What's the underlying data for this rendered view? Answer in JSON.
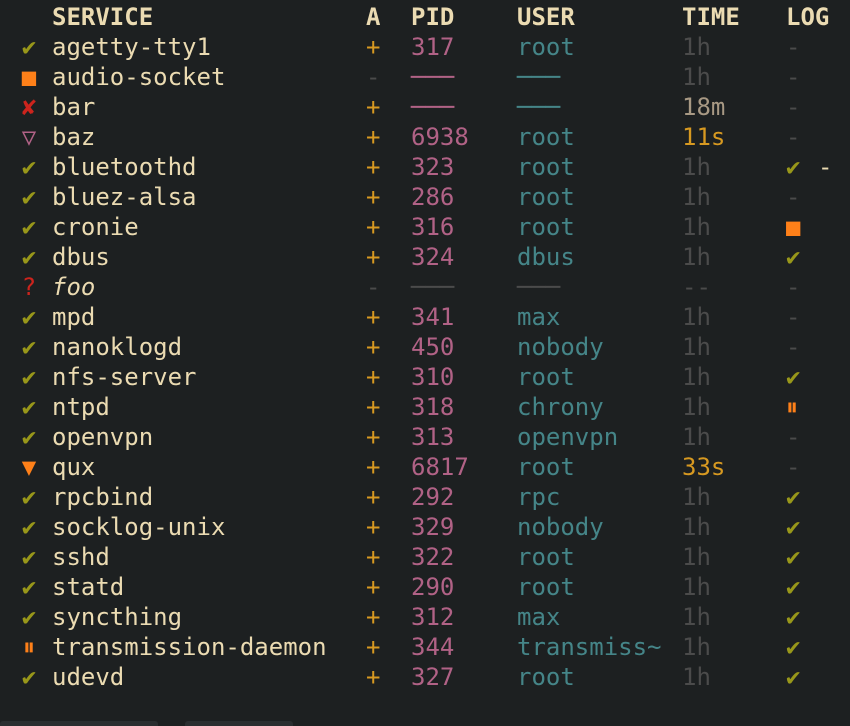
{
  "header": {
    "service": "SERVICE",
    "a": "A",
    "pid": "PID",
    "user": "USER",
    "time": "TIME",
    "log": "LOG"
  },
  "colors": {
    "bg": "#1d2021",
    "text": "#ebdbb2",
    "ok": "#98971a",
    "warn": "#fe8019",
    "err": "#cc241d",
    "pid": "#b16286",
    "user": "#458588",
    "dim": "#4b4b4b",
    "yellow": "#d79921"
  },
  "rows": [
    {
      "icon": "✔",
      "iconName": "check-icon",
      "iconClass": "green",
      "service": "agetty-tty1",
      "a": "+",
      "aClass": "yellow",
      "pid": "317",
      "pidClass": "pink",
      "user": "root",
      "userClass": "",
      "time": "1h",
      "timeClass": "dim",
      "log": "-",
      "logClass": "dim"
    },
    {
      "icon": "■",
      "iconName": "stopped-square-icon",
      "iconClass": "orange",
      "service": "audio-socket",
      "a": "-",
      "aClass": "dim",
      "pid": "───",
      "pidClass": "pink",
      "user": "───",
      "userClass": "",
      "time": "1h",
      "timeClass": "dim",
      "log": "-",
      "logClass": "dim"
    },
    {
      "icon": "✘",
      "iconName": "cross-icon",
      "iconClass": "red",
      "service": "bar",
      "a": "+",
      "aClass": "yellow",
      "pid": "───",
      "pidClass": "pink",
      "user": "───",
      "userClass": "",
      "time": "18m",
      "timeClass": "grey",
      "log": "-",
      "logClass": "dim"
    },
    {
      "icon": "▽",
      "iconName": "triangle-down-outline-icon",
      "iconClass": "pink",
      "service": "baz",
      "a": "+",
      "aClass": "yellow",
      "pid": "6938",
      "pidClass": "pink",
      "user": "root",
      "userClass": "",
      "time": "11s",
      "timeClass": "yellow",
      "log": "-",
      "logClass": "dim"
    },
    {
      "icon": "✔",
      "iconName": "check-icon",
      "iconClass": "green",
      "service": "bluetoothd",
      "a": "+",
      "aClass": "yellow",
      "pid": "323",
      "pidClass": "pink",
      "user": "root",
      "userClass": "",
      "time": "1h",
      "timeClass": "dim",
      "log": "✔",
      "logClass": "green",
      "cursor": "-"
    },
    {
      "icon": "✔",
      "iconName": "check-icon",
      "iconClass": "green",
      "service": "bluez-alsa",
      "a": "+",
      "aClass": "yellow",
      "pid": "286",
      "pidClass": "pink",
      "user": "root",
      "userClass": "",
      "time": "1h",
      "timeClass": "dim",
      "log": "-",
      "logClass": "dim"
    },
    {
      "icon": "✔",
      "iconName": "check-icon",
      "iconClass": "green",
      "service": "cronie",
      "a": "+",
      "aClass": "yellow",
      "pid": "316",
      "pidClass": "pink",
      "user": "root",
      "userClass": "",
      "time": "1h",
      "timeClass": "dim",
      "log": "■",
      "logClass": "orange"
    },
    {
      "icon": "✔",
      "iconName": "check-icon",
      "iconClass": "green",
      "service": "dbus",
      "a": "+",
      "aClass": "yellow",
      "pid": "324",
      "pidClass": "pink",
      "user": "dbus",
      "userClass": "",
      "time": "1h",
      "timeClass": "dim",
      "log": "✔",
      "logClass": "green"
    },
    {
      "icon": "?",
      "iconName": "question-icon",
      "iconClass": "red",
      "service": "foo",
      "italic": true,
      "a": "-",
      "aClass": "dim",
      "pid": "───",
      "pidClass": "dim",
      "user": "───",
      "userClass": "dim",
      "time": "--",
      "timeClass": "dim",
      "log": "-",
      "logClass": "dim"
    },
    {
      "icon": "✔",
      "iconName": "check-icon",
      "iconClass": "green",
      "service": "mpd",
      "a": "+",
      "aClass": "yellow",
      "pid": "341",
      "pidClass": "pink",
      "user": "max",
      "userClass": "",
      "time": "1h",
      "timeClass": "dim",
      "log": "-",
      "logClass": "dim"
    },
    {
      "icon": "✔",
      "iconName": "check-icon",
      "iconClass": "green",
      "service": "nanoklogd",
      "a": "+",
      "aClass": "yellow",
      "pid": "450",
      "pidClass": "pink",
      "user": "nobody",
      "userClass": "",
      "time": "1h",
      "timeClass": "dim",
      "log": "-",
      "logClass": "dim"
    },
    {
      "icon": "✔",
      "iconName": "check-icon",
      "iconClass": "green",
      "service": "nfs-server",
      "a": "+",
      "aClass": "yellow",
      "pid": "310",
      "pidClass": "pink",
      "user": "root",
      "userClass": "",
      "time": "1h",
      "timeClass": "dim",
      "log": "✔",
      "logClass": "green"
    },
    {
      "icon": "✔",
      "iconName": "check-icon",
      "iconClass": "green",
      "service": "ntpd",
      "a": "+",
      "aClass": "yellow",
      "pid": "318",
      "pidClass": "pink",
      "user": "chrony",
      "userClass": "",
      "time": "1h",
      "timeClass": "dim",
      "log": "⏸",
      "logClass": "orange"
    },
    {
      "icon": "✔",
      "iconName": "check-icon",
      "iconClass": "green",
      "service": "openvpn",
      "a": "+",
      "aClass": "yellow",
      "pid": "313",
      "pidClass": "pink",
      "user": "openvpn",
      "userClass": "",
      "time": "1h",
      "timeClass": "dim",
      "log": "-",
      "logClass": "dim"
    },
    {
      "icon": "▼",
      "iconName": "triangle-down-icon",
      "iconClass": "orange",
      "service": "qux",
      "a": "+",
      "aClass": "yellow",
      "pid": "6817",
      "pidClass": "pink",
      "user": "root",
      "userClass": "",
      "time": "33s",
      "timeClass": "yellow",
      "log": "-",
      "logClass": "dim"
    },
    {
      "icon": "✔",
      "iconName": "check-icon",
      "iconClass": "green",
      "service": "rpcbind",
      "a": "+",
      "aClass": "yellow",
      "pid": "292",
      "pidClass": "pink",
      "user": "rpc",
      "userClass": "",
      "time": "1h",
      "timeClass": "dim",
      "log": "✔",
      "logClass": "green"
    },
    {
      "icon": "✔",
      "iconName": "check-icon",
      "iconClass": "green",
      "service": "socklog-unix",
      "a": "+",
      "aClass": "yellow",
      "pid": "329",
      "pidClass": "pink",
      "user": "nobody",
      "userClass": "",
      "time": "1h",
      "timeClass": "dim",
      "log": "✔",
      "logClass": "green"
    },
    {
      "icon": "✔",
      "iconName": "check-icon",
      "iconClass": "green",
      "service": "sshd",
      "a": "+",
      "aClass": "yellow",
      "pid": "322",
      "pidClass": "pink",
      "user": "root",
      "userClass": "",
      "time": "1h",
      "timeClass": "dim",
      "log": "✔",
      "logClass": "green"
    },
    {
      "icon": "✔",
      "iconName": "check-icon",
      "iconClass": "green",
      "service": "statd",
      "a": "+",
      "aClass": "yellow",
      "pid": "290",
      "pidClass": "pink",
      "user": "root",
      "userClass": "",
      "time": "1h",
      "timeClass": "dim",
      "log": "✔",
      "logClass": "green"
    },
    {
      "icon": "✔",
      "iconName": "check-icon",
      "iconClass": "green",
      "service": "syncthing",
      "a": "+",
      "aClass": "yellow",
      "pid": "312",
      "pidClass": "pink",
      "user": "max",
      "userClass": "",
      "time": "1h",
      "timeClass": "dim",
      "log": "✔",
      "logClass": "green"
    },
    {
      "icon": "⏸",
      "iconName": "pause-icon",
      "iconClass": "orange",
      "service": "transmission-daemon",
      "a": "+",
      "aClass": "yellow",
      "pid": "344",
      "pidClass": "pink",
      "user": "transmiss~",
      "userClass": "",
      "time": "1h",
      "timeClass": "dim",
      "log": "✔",
      "logClass": "green"
    },
    {
      "icon": "✔",
      "iconName": "check-icon",
      "iconClass": "green",
      "service": "udevd",
      "a": "+",
      "aClass": "yellow",
      "pid": "327",
      "pidClass": "pink",
      "user": "root",
      "userClass": "",
      "time": "1h",
      "timeClass": "dim",
      "log": "✔",
      "logClass": "green"
    }
  ]
}
